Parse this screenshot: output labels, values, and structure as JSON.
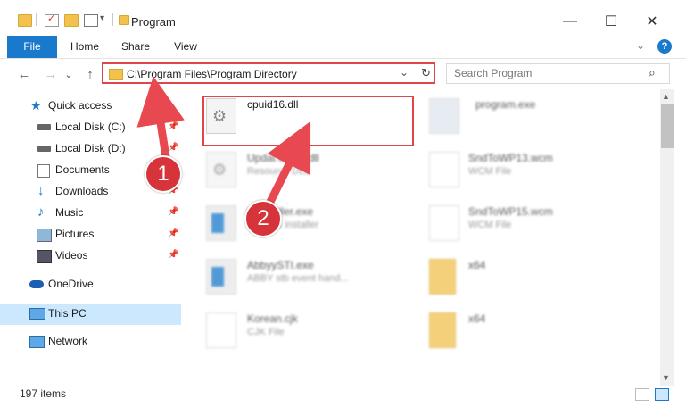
{
  "window": {
    "title": "Program",
    "minimize_glyph": "—",
    "maximize_glyph": "☐",
    "close_glyph": "✕"
  },
  "ribbon": {
    "tabs": [
      "File",
      "Home",
      "Share",
      "View"
    ],
    "help_glyph": "?",
    "expand_glyph": "⌄"
  },
  "navigation": {
    "back_glyph": "←",
    "forward_glyph": "→",
    "recent_glyph": "⌄",
    "up_glyph": "↑",
    "address": "C:\\Program Files\\Program Directory",
    "address_dropdown_glyph": "⌄",
    "refresh_glyph": "↻",
    "search_placeholder": "Search Program",
    "search_glyph": "⌕"
  },
  "sidebar": {
    "items": [
      {
        "label": "Quick access",
        "icon": "star-icon",
        "pinned": false
      },
      {
        "label": "Local Disk (C:)",
        "icon": "drive-icon",
        "pinned": true
      },
      {
        "label": "Local Disk (D:)",
        "icon": "drive-icon",
        "pinned": true
      },
      {
        "label": "Documents",
        "icon": "documents-icon",
        "pinned": true
      },
      {
        "label": "Downloads",
        "icon": "downloads-icon",
        "pinned": true
      },
      {
        "label": "Music",
        "icon": "music-icon",
        "pinned": true
      },
      {
        "label": "Pictures",
        "icon": "pictures-icon",
        "pinned": true
      },
      {
        "label": "Videos",
        "icon": "videos-icon",
        "pinned": true
      },
      {
        "label": "OneDrive",
        "icon": "cloud-icon",
        "pinned": false
      },
      {
        "label": "This PC",
        "icon": "computer-icon",
        "pinned": false,
        "selected": true
      },
      {
        "label": "Network",
        "icon": "network-icon",
        "pinned": false
      }
    ]
  },
  "files": {
    "left": [
      {
        "name": "cpuid16.dll",
        "type": "",
        "icon": "dll-gear-icon"
      },
      {
        "name": "Updat     ent65.dll",
        "type": "Resource DLL",
        "icon": "dll-gear-icon"
      },
      {
        "name": "       teInstaller.exe",
        "type": "    updates installer",
        "icon": "exe-window-icon"
      },
      {
        "name": "AbbyySTI.exe",
        "type": "ABBY stb event hand...",
        "icon": "exe-window-icon"
      },
      {
        "name": "Korean.cjk",
        "type": "CJK File",
        "icon": "blank-file-icon"
      }
    ],
    "right": [
      {
        "name": "program.exe",
        "type": "",
        "icon": "program-exe-icon"
      },
      {
        "name": "SndToWP13.wcm",
        "type": "WCM File",
        "icon": "blank-file-icon"
      },
      {
        "name": "SndToWP15.wcm",
        "type": "WCM File",
        "icon": "blank-file-icon"
      },
      {
        "name": "x64",
        "type": "",
        "icon": "folder-icon"
      },
      {
        "name": "x64",
        "type": "",
        "icon": "folder-icon"
      }
    ]
  },
  "scroll": {
    "up_glyph": "▲",
    "down_glyph": "▼"
  },
  "status": {
    "item_count": "197 items"
  },
  "annotations": {
    "step1": "1",
    "step2": "2"
  },
  "colors": {
    "accent": "#1979ca",
    "highlight": "#e0454a",
    "badge": "#d6333a",
    "selection": "#cce8ff"
  }
}
